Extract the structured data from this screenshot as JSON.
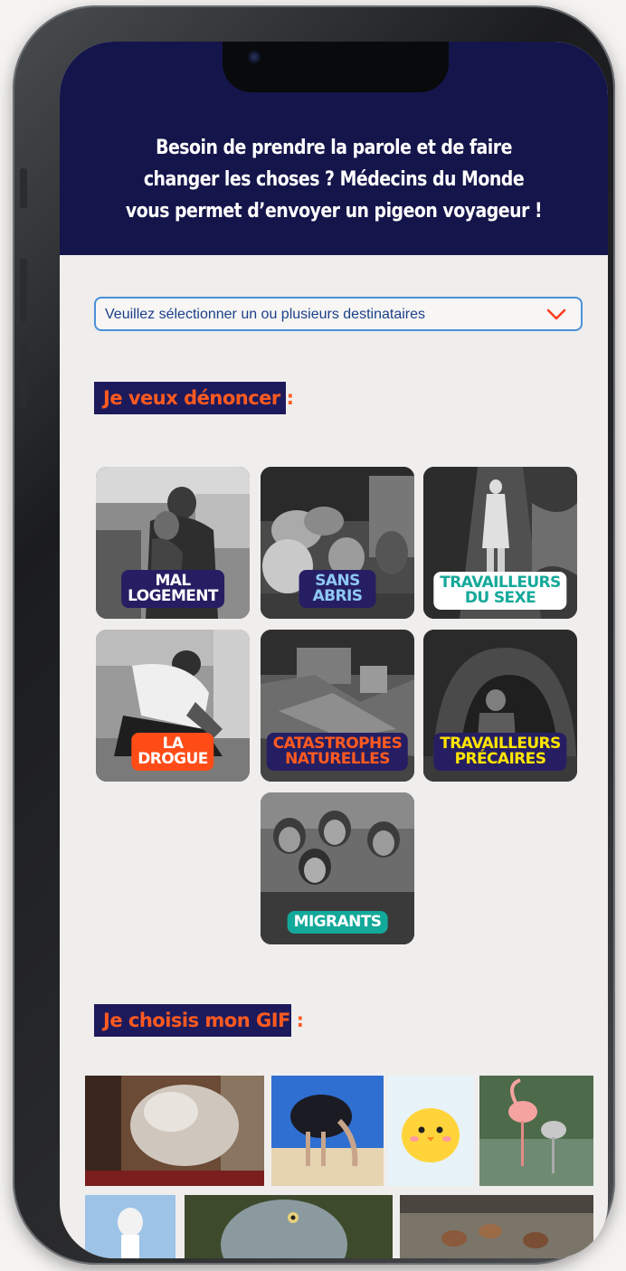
{
  "header": {
    "headline": "Besoin de prendre la parole et de faire changer les choses ? Médecins du Monde vous permet d’envoyer un pigeon voyageur !"
  },
  "recipients": {
    "placeholder": "Veuillez sélectionner un ou plusieurs destinataires",
    "icon": "chevron-down-icon"
  },
  "denounce": {
    "title": "Je veux dénoncer :",
    "tiles": [
      {
        "label": "MAL LOGEMENT",
        "image": "mother-hugging-child-photo"
      },
      {
        "label": "SANS ABRIS",
        "image": "homeless-bags-photo"
      },
      {
        "label": "TRAVAILLEURS\nDU SEXE",
        "image": "woman-in-forest-photo"
      },
      {
        "label": "LA DROGUE",
        "image": "man-crouching-photo"
      },
      {
        "label": "CATASTROPHES\nNATURELLES",
        "image": "destroyed-house-photo"
      },
      {
        "label": "TRAVAILLEURS\nPRÉCAIRES",
        "image": "miner-tunnel-photo"
      },
      {
        "label": "MIGRANTS",
        "image": "children-group-photo"
      }
    ]
  },
  "gifs": {
    "title": "Je choisis mon GIF :",
    "items": [
      "splashing-room-gif",
      "ostrich-head-in-sand-gif",
      "yellow-chick-gif",
      "flamingos-gif",
      "toy-figure-gif",
      "shoebill-bird-gif",
      "sparrows-gif"
    ]
  },
  "colors": {
    "header_bg": "#14154a",
    "title_bg": "#1d1a5c",
    "title_text": "#ff5a1f",
    "select_border": "#4a90d9",
    "chevron": "#ff3b1f"
  }
}
